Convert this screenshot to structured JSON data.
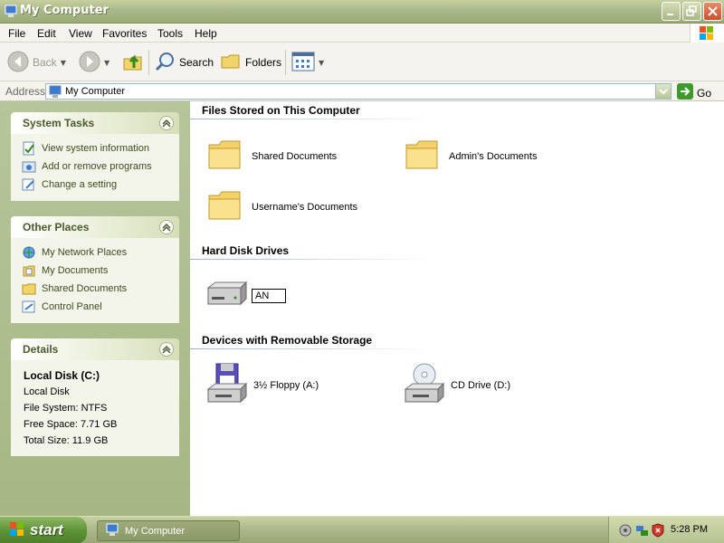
{
  "window": {
    "title": "My Computer"
  },
  "menu": [
    "File",
    "Edit",
    "View",
    "Favorites",
    "Tools",
    "Help"
  ],
  "toolbar": {
    "back": "Back",
    "search": "Search",
    "folders": "Folders"
  },
  "address": {
    "label": "Address",
    "value": "My Computer",
    "go": "Go"
  },
  "system_tasks": {
    "title": "System Tasks",
    "items": [
      "View system information",
      "Add or remove programs",
      "Change a setting"
    ]
  },
  "other_places": {
    "title": "Other Places",
    "items": [
      "My Network Places",
      "My Documents",
      "Shared Documents",
      "Control Panel"
    ]
  },
  "details": {
    "title": "Details",
    "name": "Local Disk (C:)",
    "type": "Local Disk",
    "file_system": "File System: NTFS",
    "free_space": "Free Space: 7.71 GB",
    "total_size": "Total Size: 11.9 GB"
  },
  "groups": {
    "files": {
      "title": "Files Stored on This Computer",
      "items": [
        "Shared Documents",
        "Admin's Documents",
        "Username's Documents"
      ]
    },
    "hdd": {
      "title": "Hard Disk Drives",
      "rename_value": "AN"
    },
    "removable": {
      "title": "Devices with Removable Storage",
      "items": [
        "3½ Floppy (A:)",
        "CD Drive (D:)"
      ]
    }
  },
  "taskbar": {
    "start": "start",
    "task": "My Computer",
    "clock": "5:28 PM"
  },
  "colors": {
    "title_bar": "#aab88a",
    "task_pane": "#b2c192",
    "link_text": "#3d4a1e"
  }
}
